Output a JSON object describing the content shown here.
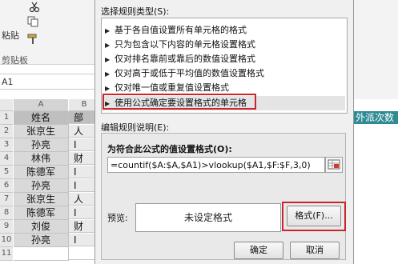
{
  "excel": {
    "paste_label": "粘贴",
    "clipboard_label": "剪贴板",
    "name_box": "A1",
    "column_a": "A",
    "column_b": "B",
    "rows": [
      {
        "num": "1",
        "a": "姓名",
        "b": "部"
      },
      {
        "num": "2",
        "a": "张京生",
        "b": "人"
      },
      {
        "num": "3",
        "a": "孙亮",
        "b": "I"
      },
      {
        "num": "4",
        "a": "林伟",
        "b": "财"
      },
      {
        "num": "5",
        "a": "陈德军",
        "b": "I"
      },
      {
        "num": "6",
        "a": "孙亮",
        "b": "I"
      },
      {
        "num": "7",
        "a": "张京生",
        "b": "人"
      },
      {
        "num": "8",
        "a": "陈德军",
        "b": "I"
      },
      {
        "num": "9",
        "a": "刘俊",
        "b": "财"
      },
      {
        "num": "10",
        "a": "孙亮",
        "b": "I"
      },
      {
        "num": "11",
        "a": "",
        "b": ""
      }
    ],
    "right_header": "外派次数"
  },
  "dialog": {
    "rule_type_label": "选择规则类型(S):",
    "rule_types": [
      "基于各自值设置所有单元格的格式",
      "只为包含以下内容的单元格设置格式",
      "仅对排名靠前或靠后的数值设置格式",
      "仅对高于或低于平均值的数值设置格式",
      "仅对唯一值或重复值设置格式",
      "使用公式确定要设置格式的单元格"
    ],
    "selected_rule_index": 5,
    "edit_desc_label": "编辑规则说明(E):",
    "formula_label": "为符合此公式的值设置格式(O):",
    "formula_value": "=countif($A:$A,$A1)>vlookup($A1,$F:$F,3,0)",
    "preview_label": "预览:",
    "preview_text": "未设定格式",
    "format_button": "格式(F)...",
    "ok_button": "确定",
    "cancel_button": "取消"
  },
  "colors": {
    "highlight_red": "#c8262d",
    "header_teal": "#2e8b94"
  }
}
